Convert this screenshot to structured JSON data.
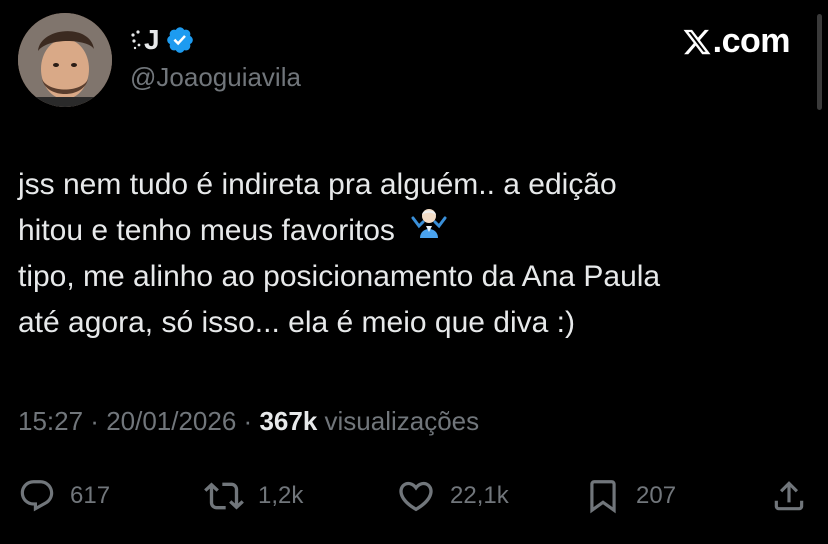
{
  "header": {
    "display_name": "J",
    "display_name_prefix_icon": "sparkle-icon",
    "verified_icon": "verified-badge-icon",
    "handle": "@Joaoguiavila",
    "brand_icon": "x-logo-icon",
    "brand_text": ".com"
  },
  "tweet": {
    "lines": [
      "jss nem tudo é indireta pra alguém.. a edição",
      "hitou e tenho meus favoritos",
      "tipo, me alinho ao posicionamento da Ana Paula",
      "até agora, só isso... ela é meio que diva :)"
    ],
    "emoji": "man-shrugging-emoji"
  },
  "meta": {
    "time": "15:27",
    "separator": " · ",
    "date": "20/01/2026",
    "views_count": "367k",
    "views_label": "visualizações"
  },
  "actions": {
    "replies": "617",
    "reposts": "1,2k",
    "likes": "22,1k",
    "bookmarks": "207"
  },
  "colors": {
    "background": "#000000",
    "text_primary": "#e7e9ea",
    "text_secondary": "#71767b",
    "verified_blue": "#1d9bf0"
  }
}
